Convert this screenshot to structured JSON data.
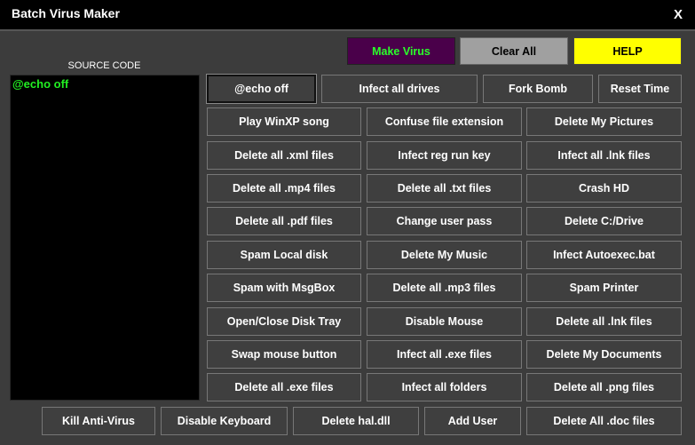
{
  "window": {
    "title": "Batch Virus Maker",
    "close_label": "X"
  },
  "top_buttons": {
    "make": "Make Virus",
    "clear": "Clear All",
    "help": "HELP"
  },
  "source": {
    "label": "SOURCE CODE",
    "code": "@echo off"
  },
  "grid": [
    [
      "@echo off",
      "Infect all drives",
      "Fork Bomb",
      "Reset Time"
    ],
    [
      "Play WinXP song",
      "Confuse file extension",
      "Delete My Pictures"
    ],
    [
      "Delete all .xml files",
      "Infect reg run key",
      "Infect all .lnk files"
    ],
    [
      "Delete all .mp4 files",
      "Delete all .txt files",
      "Crash HD"
    ],
    [
      "Delete all .pdf files",
      "Change user pass",
      "Delete C:/Drive"
    ],
    [
      "Spam Local disk",
      "Delete My Music",
      "Infect Autoexec.bat"
    ],
    [
      "Spam with MsgBox",
      "Delete all .mp3 files",
      "Spam Printer"
    ],
    [
      "Open/Close Disk Tray",
      "Disable Mouse",
      "Delete all .lnk files"
    ],
    [
      "Swap mouse button",
      "Infect all .exe files",
      "Delete My Documents"
    ],
    [
      "Delete all .exe files",
      "Infect all folders",
      "Delete all .png files"
    ]
  ],
  "bottom_row": [
    "Kill Anti-Virus",
    "Disable Keyboard",
    "Delete hal.dll",
    "Add User",
    "Delete All .doc files"
  ],
  "colors": {
    "background": "#3c3c3c",
    "make_bg": "#4a004a",
    "make_text": "#2aff2a",
    "help_bg": "#ffff00",
    "code_text": "#22ee22"
  }
}
